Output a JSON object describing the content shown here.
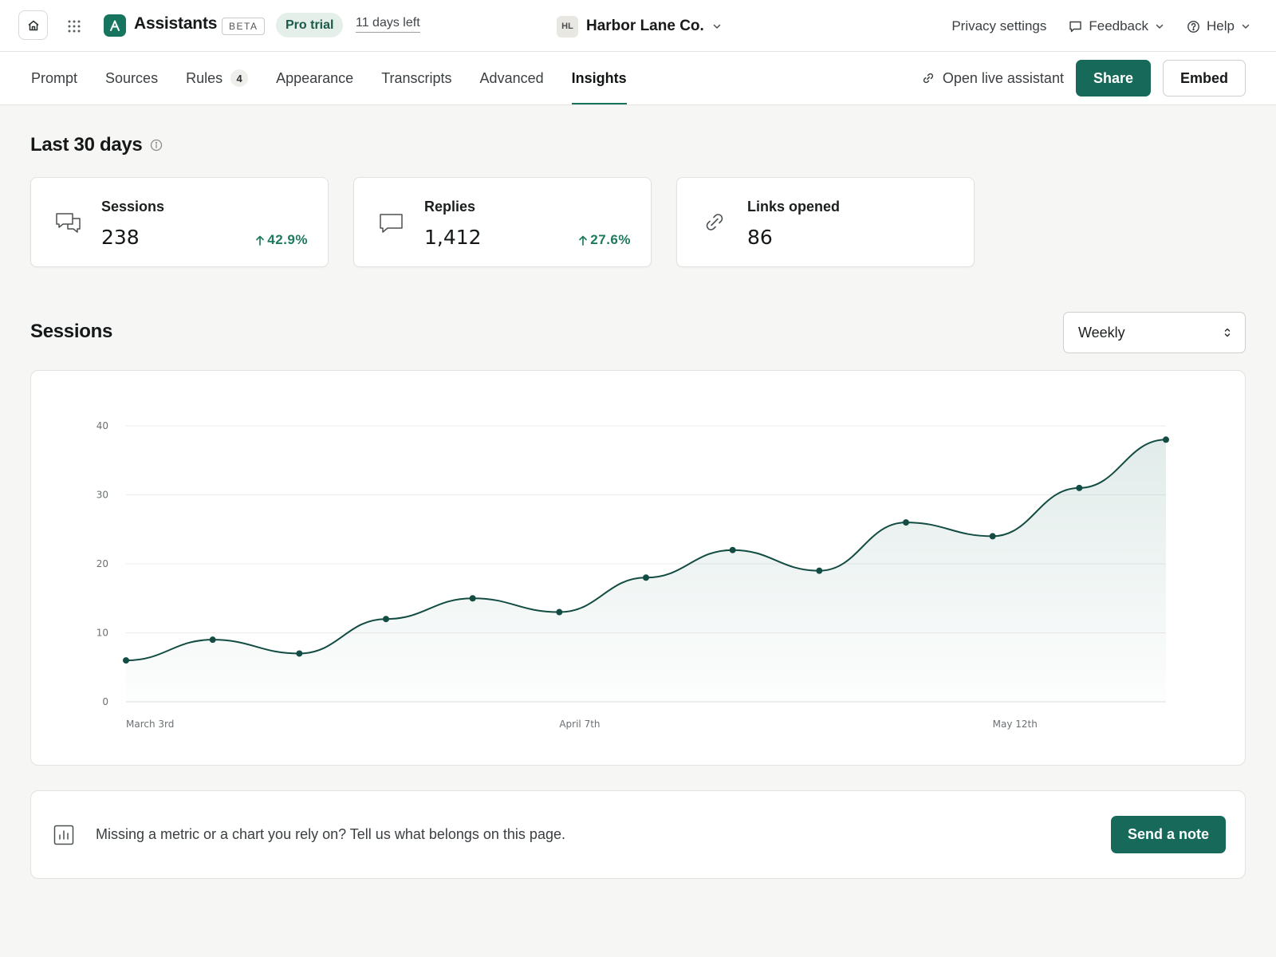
{
  "header": {
    "app_name": "Assistants",
    "beta_label": "BETA",
    "trial_label": "Pro trial",
    "days_left": "11 days left",
    "org": {
      "initials": "HL",
      "name": "Harbor Lane Co."
    },
    "links": {
      "privacy": "Privacy settings",
      "feedback": "Feedback",
      "help": "Help"
    }
  },
  "tabs": [
    {
      "label": "Prompt"
    },
    {
      "label": "Sources"
    },
    {
      "label": "Rules",
      "count": "4"
    },
    {
      "label": "Appearance"
    },
    {
      "label": "Transcripts"
    },
    {
      "label": "Advanced"
    },
    {
      "label": "Insights",
      "active": true
    }
  ],
  "actions": {
    "open_live": "Open live assistant",
    "share": "Share",
    "embed": "Embed"
  },
  "period_heading": "Last 30 days",
  "stats": [
    {
      "label": "Sessions",
      "value": "238",
      "change": "42.9%"
    },
    {
      "label": "Replies",
      "value": "1,412",
      "change": "27.6%"
    },
    {
      "label": "Links opened",
      "value": "86"
    }
  ],
  "chart_section": {
    "title": "Sessions",
    "select_value": "Weekly"
  },
  "chart_data": {
    "type": "area",
    "title": "Sessions",
    "xlabel": "",
    "ylabel": "",
    "x_tick_labels": [
      {
        "index": 0,
        "label": "March 3rd"
      },
      {
        "index": 5,
        "label": "April 7th"
      },
      {
        "index": 10,
        "label": "May 12th"
      }
    ],
    "y_ticks": [
      0,
      10,
      20,
      30,
      40
    ],
    "ylim": [
      0,
      40
    ],
    "grid": true,
    "legend": "none",
    "series": [
      {
        "values": [
          6,
          9,
          7,
          12,
          15,
          13,
          18,
          22,
          19,
          26,
          24,
          31,
          38
        ]
      }
    ],
    "colors": {
      "line": "#124c42",
      "fill": "#1b6b5c"
    }
  },
  "feedback": {
    "text": "Missing a metric or a chart you rely on? Tell us what belongs on this page.",
    "button": "Send a note"
  }
}
